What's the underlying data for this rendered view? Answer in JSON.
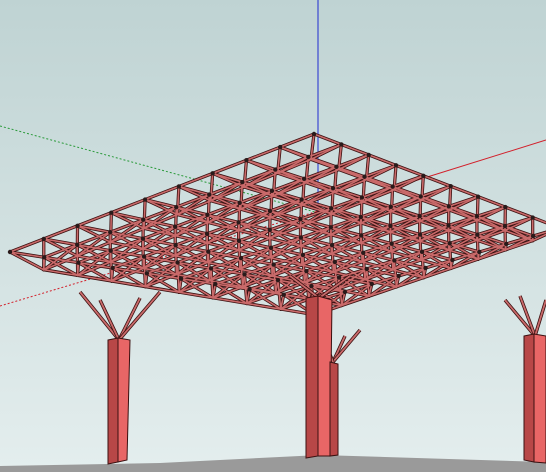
{
  "viewport": {
    "colors": {
      "sky_top": "#bfd3d3",
      "sky_bottom": "#e4eeee",
      "ground": "#9a9a9a",
      "axis_blue": "#1f2bd0",
      "axis_red": "#d21f2a",
      "axis_green": "#2a9a3a",
      "truss_fill": "#c96a6a",
      "truss_edge": "#3a1010",
      "column_fill": "#e86666",
      "column_shade": "#b84747",
      "column_edge": "#3a1010",
      "node": "#2a1a1a"
    }
  }
}
